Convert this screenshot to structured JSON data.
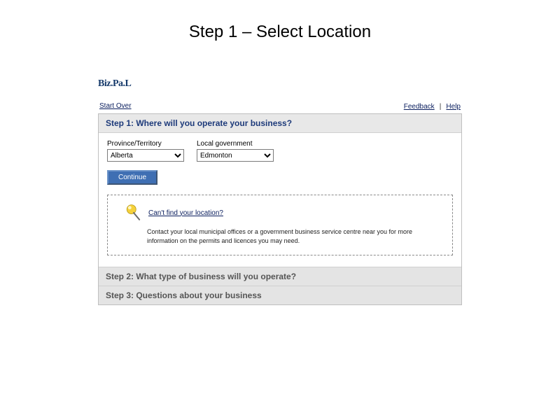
{
  "slide": {
    "title": "Step 1 – Select Location"
  },
  "brand": "Biz.Pa.L",
  "topbar": {
    "start_over": "Start Over",
    "feedback": "Feedback",
    "help": "Help",
    "sep": "|"
  },
  "step1": {
    "heading": "Step 1: Where will you operate your business?",
    "province_label": "Province/Territory",
    "province_value": "Alberta",
    "localgov_label": "Local government",
    "localgov_value": "Edmonton",
    "continue": "Continue",
    "hint_q": "Can't find your location?",
    "hint_text": "Contact your local municipal offices or a government business service centre near you for more information on the permits and licences you may need."
  },
  "step2": {
    "heading": "Step 2: What type of business will you operate?"
  },
  "step3": {
    "heading": "Step 3: Questions about your business"
  }
}
